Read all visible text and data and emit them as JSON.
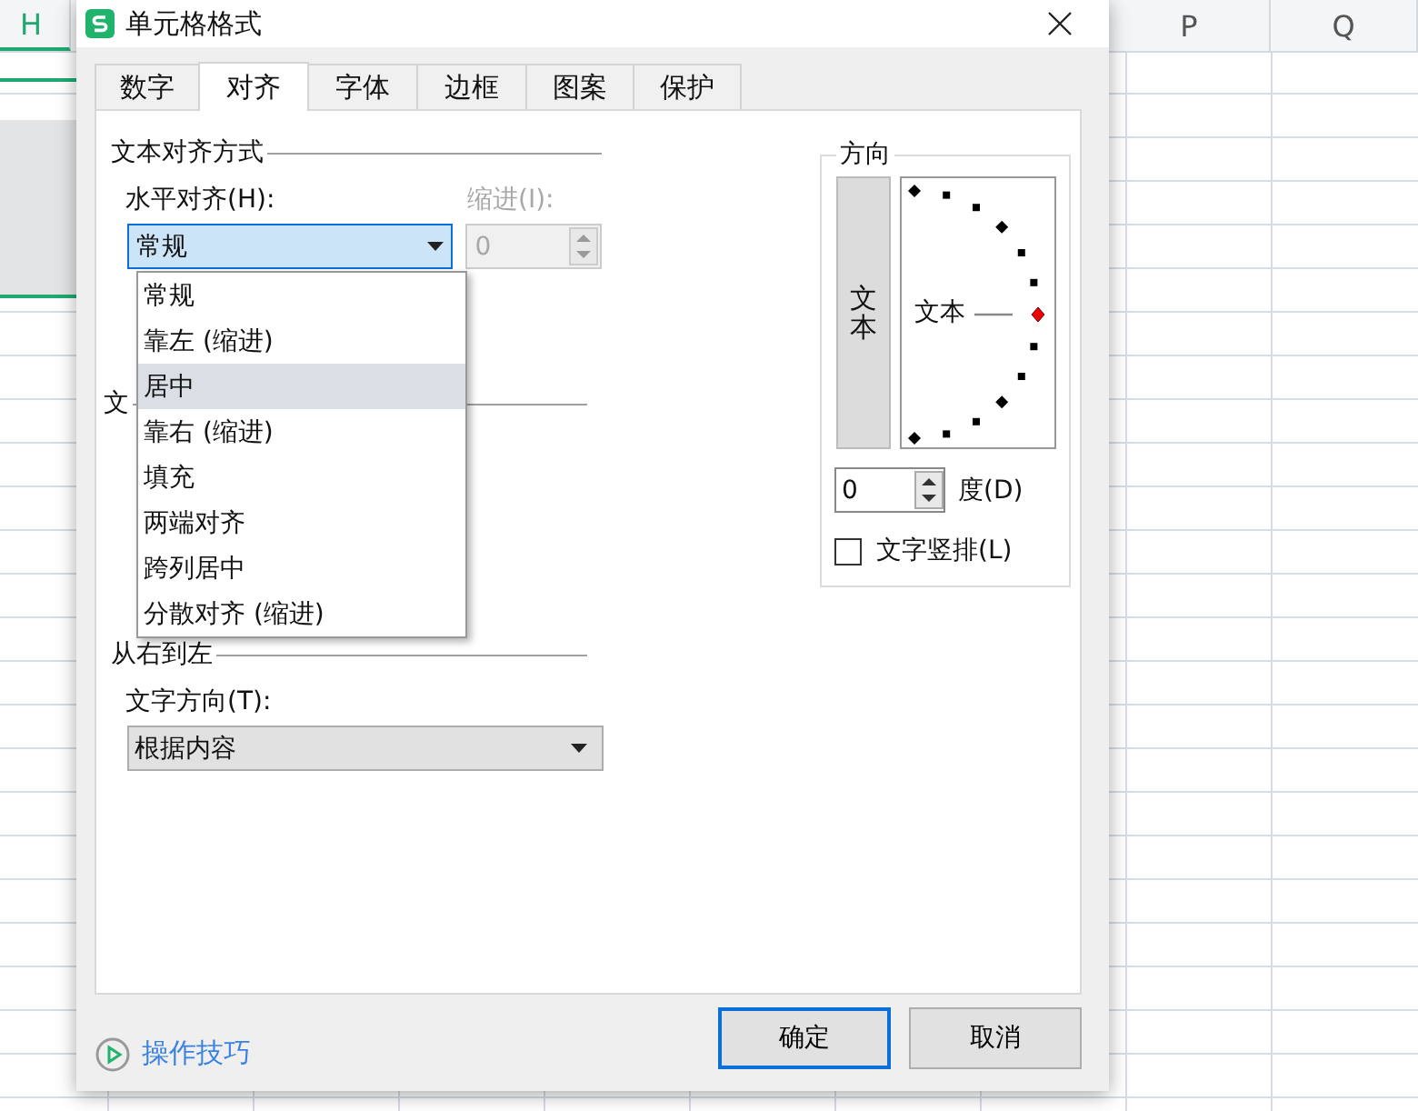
{
  "sheet": {
    "columns_left": [
      "H"
    ],
    "columns_right": [
      "P",
      "Q"
    ]
  },
  "dialog": {
    "title": "单元格格式",
    "tabs": [
      {
        "label": "数字",
        "selected": false
      },
      {
        "label": "对齐",
        "selected": true
      },
      {
        "label": "字体",
        "selected": false
      },
      {
        "label": "边框",
        "selected": false
      },
      {
        "label": "图案",
        "selected": false
      },
      {
        "label": "保护",
        "selected": false
      }
    ],
    "alignment": {
      "heading": "文本对齐方式",
      "horizontal_label": "水平对齐(H):",
      "horizontal_value": "常规",
      "indent_label": "缩进(I):",
      "indent_value": "0",
      "indent_disabled": true,
      "options": [
        {
          "label": "常规",
          "selected": false
        },
        {
          "label": "靠左 (缩进)",
          "selected": false
        },
        {
          "label": "居中",
          "selected": true
        },
        {
          "label": "靠右 (缩进)",
          "selected": false
        },
        {
          "label": "填充",
          "selected": false
        },
        {
          "label": "两端对齐",
          "selected": false
        },
        {
          "label": "跨列居中",
          "selected": false
        },
        {
          "label": "分散对齐 (缩进)",
          "selected": false
        }
      ]
    },
    "text_control": {
      "heading": "文"
    },
    "right_to_left": {
      "heading": "从右到左",
      "direction_label": "文字方向(T):",
      "direction_value": "根据内容"
    },
    "orientation": {
      "heading": "方向",
      "vertical_text": "文本",
      "dial_text": "文本",
      "degrees_value": "0",
      "degrees_label": "度(D)",
      "stacked_label": "文字竖排(L)",
      "stacked_checked": false
    },
    "tips_link": "操作技巧",
    "buttons": [
      {
        "label": "确定",
        "kind": "default"
      },
      {
        "label": "取消",
        "kind": "normal"
      }
    ]
  }
}
